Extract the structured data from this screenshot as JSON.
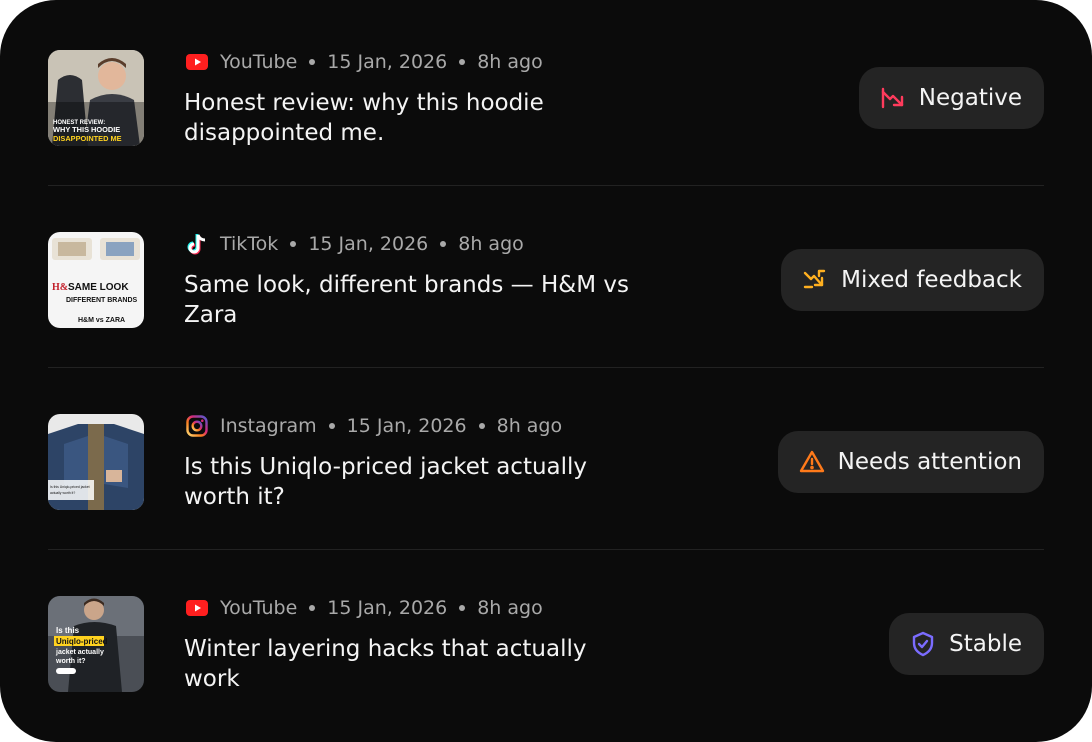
{
  "feed": {
    "items": [
      {
        "platform": "YouTube",
        "platform_icon": "youtube-icon",
        "date": "15 Jan, 2026",
        "age": "8h ago",
        "title": "Honest review: why this hoodie disappointed me.",
        "thumbnail_text": [
          "HONEST REVIEW:",
          "WHY THIS HOODIE",
          "DISAPPOINTED ME"
        ],
        "status": {
          "label": "Negative",
          "icon": "trend-down-icon",
          "color": "#ff3b5c"
        }
      },
      {
        "platform": "TikTok",
        "platform_icon": "tiktok-icon",
        "date": "15 Jan, 2026",
        "age": "8h ago",
        "title": "Same look, different brands — H&M vs Zara",
        "thumbnail_text": [
          "SAME LOOK",
          "DIFFERENT BRANDS",
          "H&M vs ZARA"
        ],
        "status": {
          "label": "Mixed feedback",
          "icon": "trend-mixed-icon",
          "color": "#ffb020"
        }
      },
      {
        "platform": "Instagram",
        "platform_icon": "instagram-icon",
        "date": "15 Jan, 2026",
        "age": "8h ago",
        "title": "Is this Uniqlo-priced jacket actually worth it?",
        "thumbnail_text": [
          "Is this Uniqlo-priced jacket",
          "actually worth it?"
        ],
        "status": {
          "label": "Needs attention",
          "icon": "warning-icon",
          "color": "#ff7a1a"
        }
      },
      {
        "platform": "YouTube",
        "platform_icon": "youtube-icon",
        "date": "15 Jan, 2026",
        "age": "8h ago",
        "title": "Winter layering hacks that actually work",
        "thumbnail_text": [
          "Is this",
          "Uniqlo-priced",
          "jacket actually",
          "worth it?"
        ],
        "status": {
          "label": "Stable",
          "icon": "shield-check-icon",
          "color": "#7b6cff"
        }
      }
    ]
  }
}
